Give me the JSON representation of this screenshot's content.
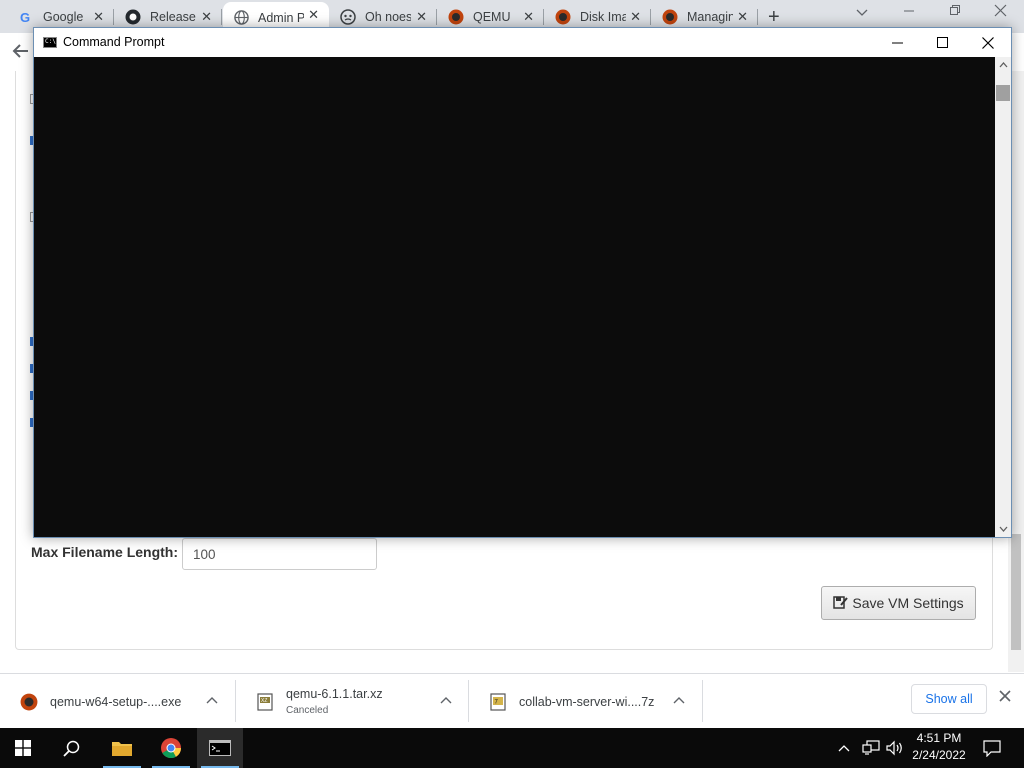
{
  "browser": {
    "tabs": [
      {
        "title": "Google",
        "icon": "google-icon",
        "active": false
      },
      {
        "title": "Releases",
        "icon": "github-icon",
        "active": false
      },
      {
        "title": "Admin Panel",
        "icon": "globe-icon",
        "active": true
      },
      {
        "title": "Oh noes",
        "icon": "mascot-icon",
        "active": false
      },
      {
        "title": "QEMU",
        "icon": "qemu-icon",
        "active": false
      },
      {
        "title": "Disk Images",
        "icon": "qemu-icon",
        "active": false
      },
      {
        "title": "Managing",
        "icon": "qemu-icon",
        "active": false
      }
    ],
    "close_glyph": "✕",
    "new_tab_glyph": "+"
  },
  "page": {
    "max_filename_label": "Max Filename Length:",
    "max_filename_value": "100",
    "save_button_label": "Save VM Settings"
  },
  "cmd": {
    "title": "Command Prompt",
    "minimize_glyph": "—",
    "maximize_glyph": "☐",
    "close_glyph": "✕"
  },
  "downloads": {
    "items": [
      {
        "name": "qemu-w64-setup-....exe",
        "status": ""
      },
      {
        "name": "qemu-6.1.1.tar.xz",
        "status": "Canceled"
      },
      {
        "name": "collab-vm-server-wi....7z",
        "status": ""
      }
    ],
    "show_all_label": "Show all"
  },
  "taskbar": {
    "time": "4:51 PM",
    "date": "2/24/2022"
  },
  "colors": {
    "console_bg": "#0c0c0c",
    "taskbar_bg": "#0a0a0a",
    "link_blue": "#1a73e8",
    "checkbox_blue": "#2f6fc9"
  }
}
